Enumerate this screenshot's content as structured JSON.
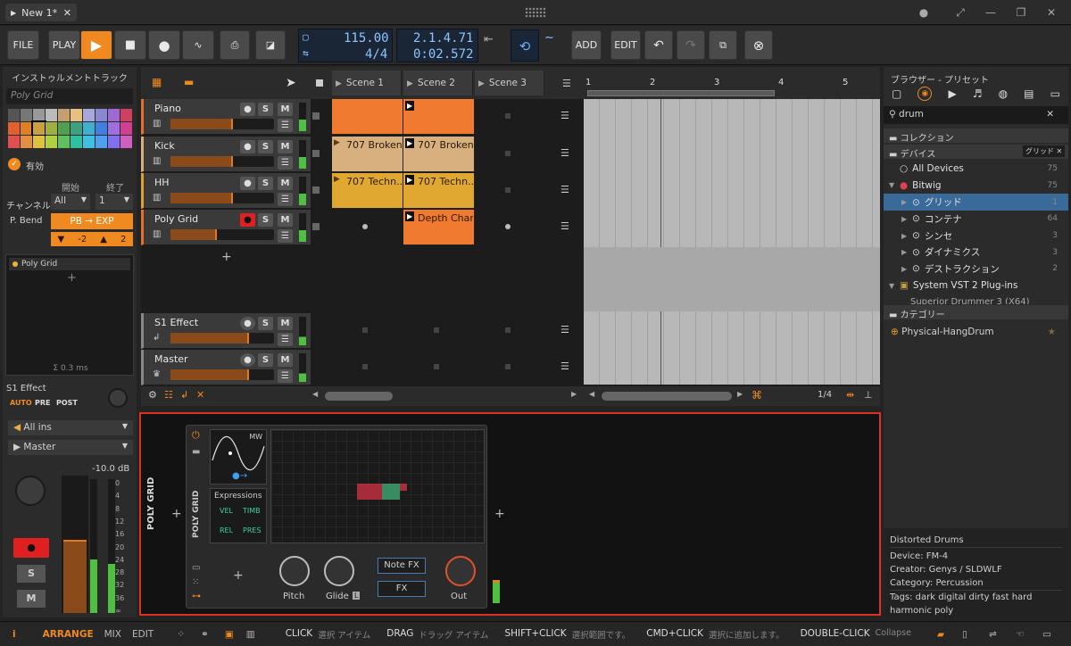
{
  "window": {
    "tab_title": "New 1*"
  },
  "transport": {
    "file": "FILE",
    "play": "PLAY",
    "tempo": "115.00",
    "signature": "4/4",
    "position": "2.1.4.71",
    "time": "0:02.572",
    "add": "ADD",
    "edit": "EDIT"
  },
  "inspector": {
    "title": "インストゥルメントトラック",
    "name": "Poly Grid",
    "enabled": "有効",
    "channel_label": "チャンネル",
    "start_label": "開始",
    "end_label": "終了",
    "channel_start": "All",
    "channel_end": "1",
    "pbend_label": "P. Bend",
    "pbend_button": "PB → EXP",
    "pbend_down": "-2",
    "pbend_up": "2",
    "device_chip": "Poly Grid",
    "latency": "Σ 0.3 ms",
    "send_name": "S1 Effect",
    "send_modes": [
      "AUTO",
      "PRE",
      "POST"
    ],
    "input": "All ins",
    "output": "Master",
    "level": "-10.0 dB",
    "meter_scale": [
      "0",
      "4",
      "8",
      "12",
      "16",
      "20",
      "24",
      "28",
      "32",
      "36",
      "∞"
    ],
    "solo": "S",
    "mute": "M"
  },
  "palette": [
    "#555555",
    "#777777",
    "#999999",
    "#bbbbbb",
    "#c4a070",
    "#e8c080",
    "#a8a8d8",
    "#8888d0",
    "#9c6ad0",
    "#d04060",
    "#e06030",
    "#e08020",
    "#c8a040",
    "#a0b040",
    "#50a050",
    "#40a080",
    "#40b0d0",
    "#4080e0",
    "#a070e0",
    "#d04090",
    "#e05050",
    "#e09040",
    "#e0c040",
    "#b0d040",
    "#60c060",
    "#30c0a0",
    "#40c0e0",
    "#50a0f0",
    "#8070f0",
    "#d060c0"
  ],
  "tracks": [
    {
      "name": "Piano",
      "color": "#e8702a",
      "vol": 0.6
    },
    {
      "name": "Kick",
      "color": "#d8b080",
      "vol": 0.6
    },
    {
      "name": "HH",
      "color": "#e0a030",
      "vol": 0.6
    },
    {
      "name": "Poly Grid",
      "color": "#e8702a",
      "vol": 0.45
    }
  ],
  "effect_tracks": [
    {
      "name": "S1 Effect",
      "vol": 0.76
    },
    {
      "name": "Master",
      "vol": 0.76
    }
  ],
  "scenes": [
    "Scene 1",
    "Scene 2",
    "Scene 3"
  ],
  "clips": {
    "kick1": "707 Broken...",
    "kick2": "707 Broken...",
    "hh1": "707 Techn...",
    "hh2": "707 Techn...",
    "poly2": "Depth Char..."
  },
  "ruler": [
    "1",
    "2",
    "3",
    "4",
    "5"
  ],
  "zoom": "1/4",
  "browser": {
    "title": "ブラウザー - プリセット",
    "search": "drum",
    "collection": "コレクション",
    "devices": "デバイス",
    "filter_chip": "グリッド",
    "items": [
      {
        "label": "All Devices",
        "count": "75"
      },
      {
        "label": "Bitwig",
        "count": "75"
      },
      {
        "label": "グリッド",
        "count": "1"
      },
      {
        "label": "コンテナ",
        "count": "64"
      },
      {
        "label": "シンセ",
        "count": "3"
      },
      {
        "label": "ダイナミクス",
        "count": "3"
      },
      {
        "label": "デストラクション",
        "count": "2"
      },
      {
        "label": "System VST 2 Plug-ins",
        "count": ""
      }
    ],
    "partial": "Superior Drummer 3 (X64)",
    "category": "カテゴリー",
    "result": "Physical-HangDrum"
  },
  "info": {
    "title": "Distorted Drums",
    "device": "Device: FM-4",
    "creator": "Creator: Genys / SLDWLF",
    "category": "Category: Percussion",
    "tags": "Tags: dark digital dirty fast hard harmonic poly"
  },
  "device": {
    "outer": "POLY GRID",
    "inner": "POLY GRID",
    "mw": "MW",
    "expressions": "Expressions",
    "vel": "VEL",
    "timb": "TIMB",
    "rel": "REL",
    "pres": "PRES",
    "pitch": "Pitch",
    "glide": "Glide",
    "glide_badge": "L",
    "out": "Out",
    "notefx": "Note FX",
    "fx": "FX"
  },
  "status": {
    "arrange": "ARRANGE",
    "mix": "MIX",
    "edit": "EDIT",
    "hints": [
      [
        "CLICK",
        "選択 アイテム"
      ],
      [
        "DRAG",
        "ドラッグ アイテム"
      ],
      [
        "SHIFT+CLICK",
        "選択範囲です。"
      ],
      [
        "CMD+CLICK",
        "選択に追加します。"
      ],
      [
        "DOUBLE-CLICK",
        "Collapse"
      ]
    ]
  }
}
